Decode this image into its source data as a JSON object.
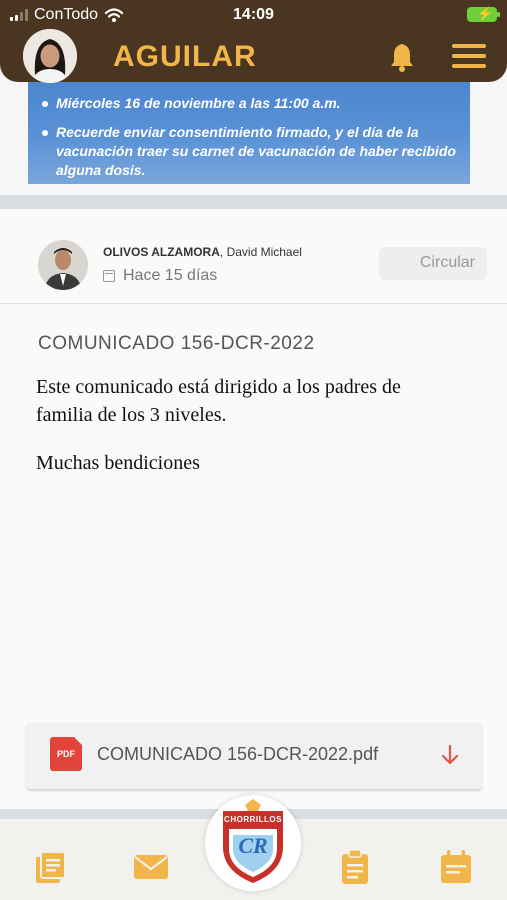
{
  "status_bar": {
    "carrier": "ConTodo",
    "time": "14:09"
  },
  "header": {
    "title": "AGUILAR"
  },
  "banner": {
    "lines": [
      "Miércoles 16 de noviembre a las 11:00 a.m.",
      "Recuerde enviar consentimiento firmado, y el día de la vacunación traer su carnet de vacunación de haber recibido alguna dosis."
    ]
  },
  "post": {
    "author_last": "OLIVOS ALZAMORA",
    "author_first": "David Michael",
    "time": "Hace 15 días",
    "tag": "Circular",
    "title": "COMUNICADO 156-DCR-2022",
    "body": [
      "Este comunicado está dirigido a los padres de familia de los 3 niveles.",
      "Muchas bendiciones"
    ],
    "attachment": {
      "name": "COMUNICADO 156-DCR-2022.pdf",
      "icon_label": "PDF"
    }
  },
  "logo": {
    "text": "CHORRILLOS",
    "initials": "CR"
  },
  "colors": {
    "header_bg": "#4a3520",
    "accent": "#f0b64a",
    "pdf_red": "#e0443a"
  },
  "icons": [
    "wifi-icon",
    "battery-icon",
    "bell-icon",
    "menu-icon",
    "calendar-icon",
    "pdf-icon",
    "download-icon",
    "list-icon",
    "mail-icon",
    "clipboard-icon",
    "calendar-nav-icon"
  ]
}
